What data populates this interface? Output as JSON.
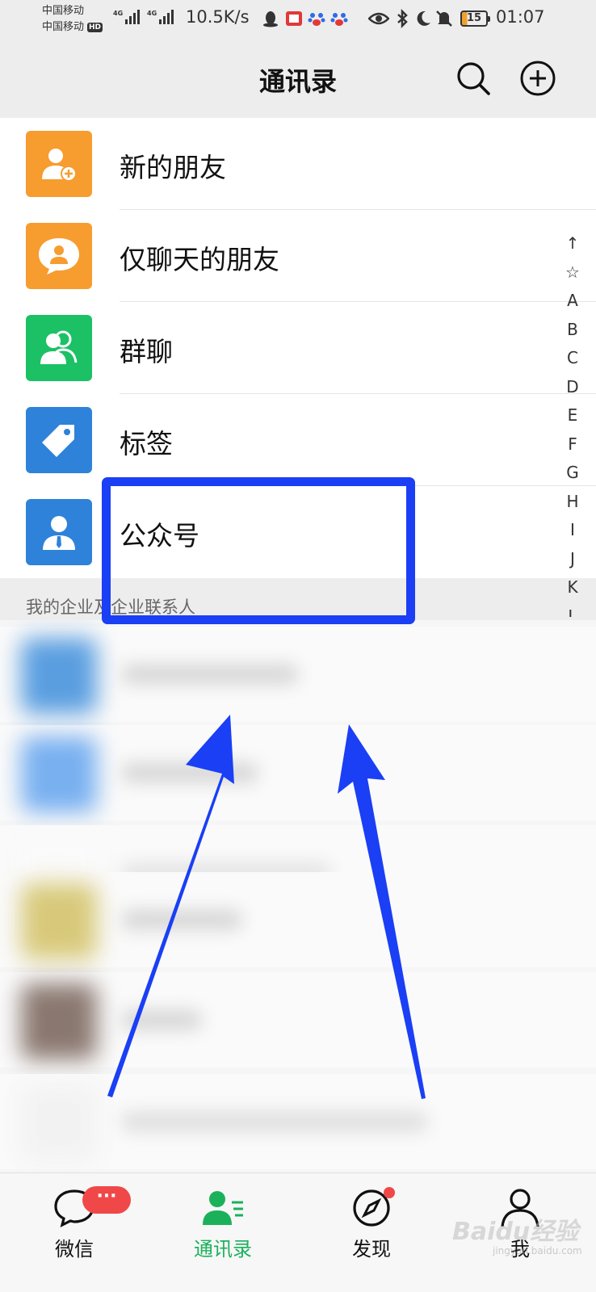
{
  "status_bar": {
    "carrier_1": "中国移动",
    "carrier_2": "中国移动",
    "hd": "HD",
    "net_type": "4G",
    "net_speed": "10.5K/s",
    "battery": "15",
    "time": "01:07"
  },
  "header": {
    "title": "通讯录"
  },
  "function_rows": [
    {
      "label": "新的朋友",
      "icon": "add-friend-icon"
    },
    {
      "label": "仅聊天的朋友",
      "icon": "chat-only-friend-icon"
    },
    {
      "label": "群聊",
      "icon": "group-chat-icon"
    },
    {
      "label": "标签",
      "icon": "tag-icon"
    },
    {
      "label": "公众号",
      "icon": "official-account-icon"
    }
  ],
  "index_letters": [
    "↑",
    "☆",
    "A",
    "B",
    "C",
    "D",
    "E",
    "F",
    "G",
    "H",
    "I",
    "J",
    "K",
    "L"
  ],
  "section": {
    "enterprise_header": "我的企业及企业联系人"
  },
  "tab_bar": {
    "tabs": [
      {
        "label": "微信",
        "icon": "chat-bubble-icon"
      },
      {
        "label": "通讯录",
        "icon": "contacts-icon"
      },
      {
        "label": "发现",
        "icon": "compass-icon"
      },
      {
        "label": "我",
        "icon": "person-icon"
      }
    ],
    "chat_badge": "···"
  },
  "watermark": {
    "brand": "Baidu经验",
    "url": "jingyan.baidu.com"
  },
  "colors": {
    "accent_green": "#1bb15b",
    "annotation_blue": "#1a3ff5",
    "badge_red": "#f04848",
    "tile_orange": "#f79c2e",
    "tile_green": "#1bc164",
    "tile_blue": "#2e82d9"
  }
}
